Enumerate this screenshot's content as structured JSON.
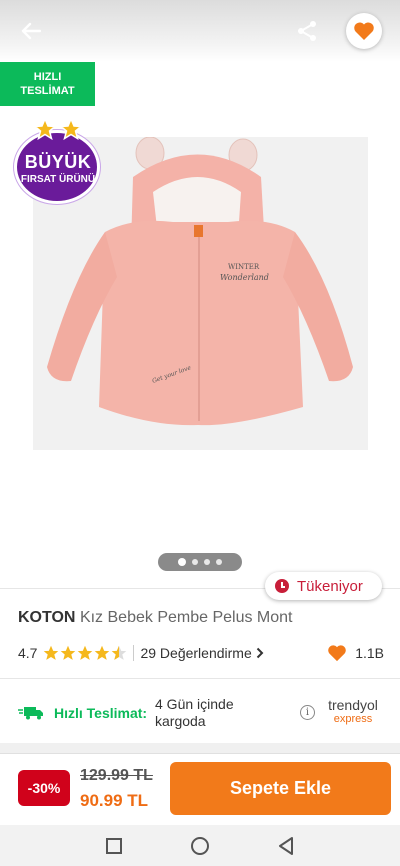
{
  "badges": {
    "fast_delivery_line1": "HIZLI",
    "fast_delivery_line2": "TESLİMAT",
    "big_deal_line1": "BÜYÜK",
    "big_deal_line2": "FIRSAT ÜRÜNÜ"
  },
  "icons": {
    "back": "arrow-left-icon",
    "share": "share-icon",
    "favorite": "heart-icon"
  },
  "gallery": {
    "image_count": 4,
    "active_index": 0,
    "stock_status": "Tükeniyor"
  },
  "product": {
    "brand": "KOTON",
    "name": "Kız Bebek Pembe Pelus Mont",
    "rating": "4.7",
    "rating_value": 4.7,
    "reviews": "29 Değerlendirme",
    "favorites": "1.1B"
  },
  "delivery": {
    "label": "Hızlı Teslimat:",
    "eta": "4 Gün içinde kargoda",
    "partner_line1": "trendyol",
    "partner_line2": "express"
  },
  "purchase": {
    "discount": "-30%",
    "old_price": "129.99 TL",
    "new_price": "90.99 TL",
    "add_to_cart": "Sepete Ekle"
  },
  "colors": {
    "brand_orange": "#f27a1a",
    "fast_green": "#0cba5a",
    "discount_red": "#d0021b",
    "stock_red": "#c81e39"
  }
}
